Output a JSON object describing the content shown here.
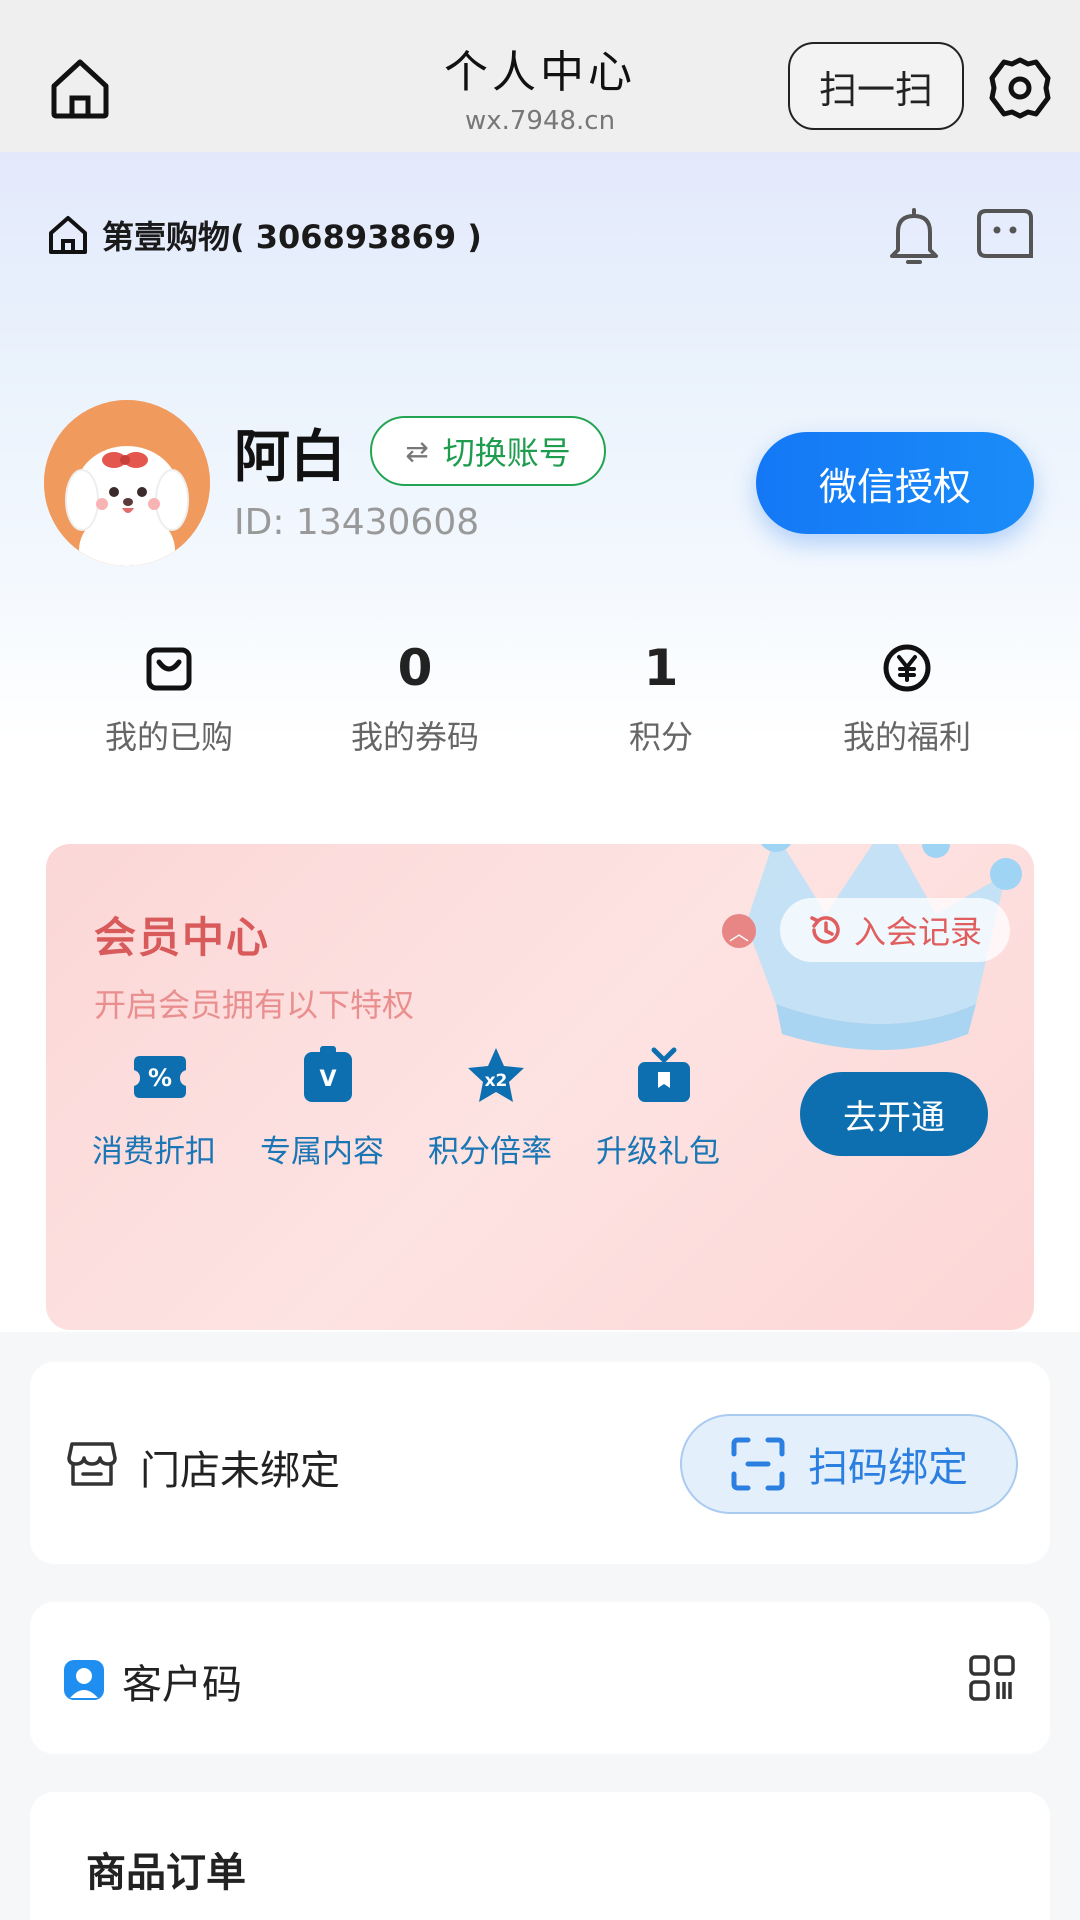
{
  "header": {
    "title": "个人中心",
    "domain": "wx.7948.cn",
    "scan_label": "扫一扫"
  },
  "shop": {
    "name": "第壹购物( 306893869 )"
  },
  "profile": {
    "username": "阿白",
    "switch_label": "切换账号",
    "user_id": "ID: 13430608",
    "wechat_auth_label": "微信授权"
  },
  "stats": [
    {
      "value": "",
      "label": "我的已购",
      "icon": "bag-icon"
    },
    {
      "value": "0",
      "label": "我的券码"
    },
    {
      "value": "1",
      "label": "积分"
    },
    {
      "value": "",
      "label": "我的福利",
      "icon": "yen-coin-icon"
    }
  ],
  "member": {
    "title": "会员中心",
    "subtitle": "开启会员拥有以下特权",
    "record_label": "入会记录",
    "open_label": "去开通",
    "perks": [
      {
        "label": "消费折扣",
        "icon": "discount-ticket-icon"
      },
      {
        "label": "专属内容",
        "icon": "vip-badge-icon"
      },
      {
        "label": "积分倍率",
        "icon": "star-x2-icon"
      },
      {
        "label": "升级礼包",
        "icon": "gift-box-icon"
      }
    ]
  },
  "store": {
    "status_text": "门店未绑定",
    "bind_label": "扫码绑定"
  },
  "customer_code": {
    "label": "客户码"
  },
  "orders": {
    "title": "商品订单"
  },
  "colors": {
    "primary_blue": "#1478f6",
    "green": "#23a453",
    "member_red": "#d85a5a",
    "perk_blue": "#1a76b4",
    "open_btn": "#0d6fb0"
  }
}
